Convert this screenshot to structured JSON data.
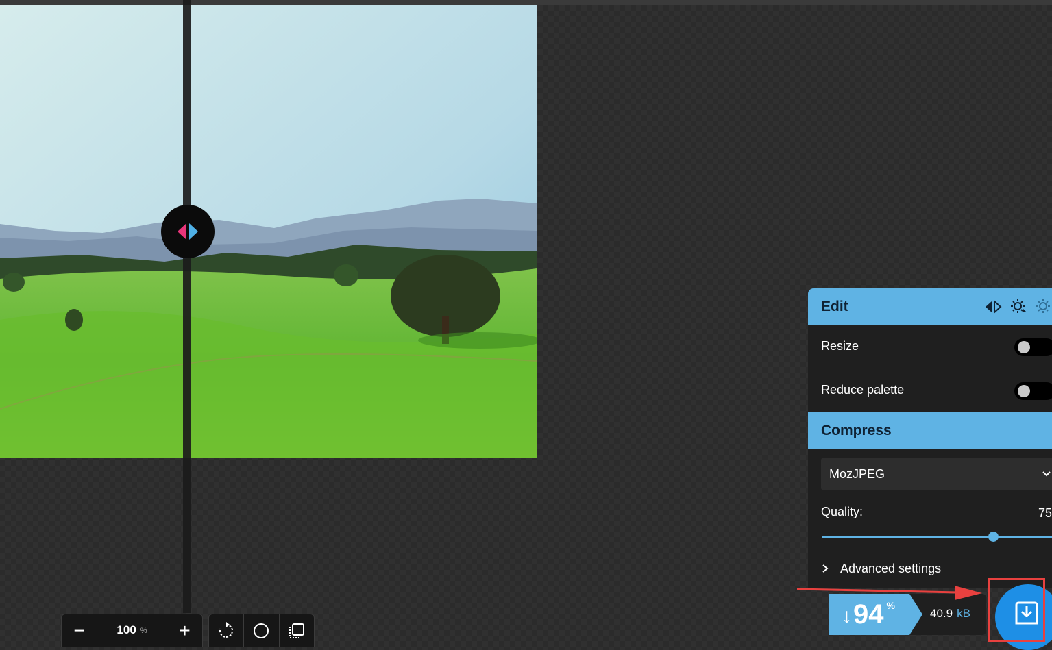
{
  "zoom": {
    "minus_label": "−",
    "value": "100",
    "unit": "%",
    "plus_label": "+"
  },
  "tools": {
    "rotate_icon": "rotate-icon",
    "background_icon": "circle-icon",
    "crop_icon": "crop-icon"
  },
  "edit_panel": {
    "title": "Edit",
    "options": [
      {
        "label": "Resize",
        "enabled": false
      },
      {
        "label": "Reduce palette",
        "enabled": false
      }
    ]
  },
  "compress_panel": {
    "title": "Compress",
    "codec": "MozJPEG",
    "quality_label": "Quality:",
    "quality_value": "75",
    "advanced_label": "Advanced settings"
  },
  "result": {
    "arrow": "↓",
    "percent": "94",
    "percent_symbol": "%",
    "size": "40.9",
    "size_unit": "kB"
  },
  "colors": {
    "accent": "#5fb3e4",
    "download": "#1e8fe6",
    "highlight": "#e8413f"
  }
}
